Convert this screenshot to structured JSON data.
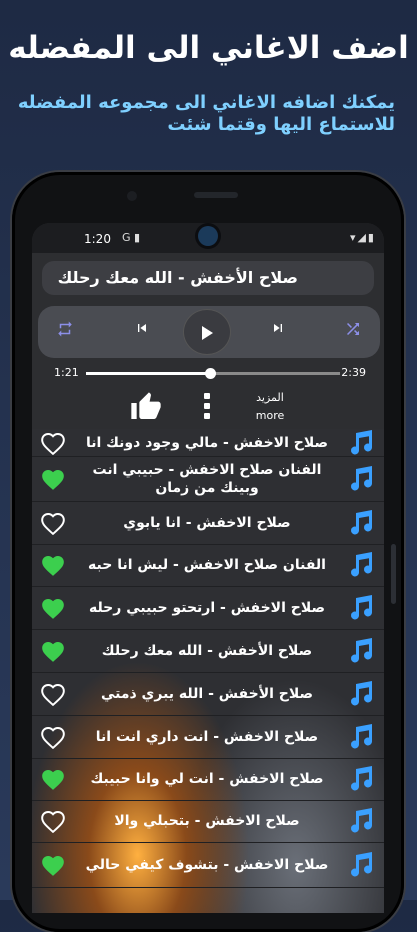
{
  "promo": {
    "title": "اضف الاغاني الى المفضله",
    "subtitle": "يمكنك اضافه الاغاني الى مجموعه المفضله للاستماع اليها وقتما شئت"
  },
  "status": {
    "time": "1:20",
    "left_icons": "G ▮",
    "right_icons": "▾◢▮"
  },
  "player": {
    "now_playing": "صلاح الأخفش - الله معك رحلك",
    "elapsed": "1:21",
    "duration": "2:39",
    "progress": 0.49,
    "more_ar": "المزيد",
    "more_en": "more"
  },
  "colors": {
    "accent": "#8c8fe8",
    "note": "#3aa0ff",
    "fav": "#3ccf4e"
  },
  "songs": [
    {
      "title": "صلاح الاخفش - مالي وجود دونك انا",
      "fav": false
    },
    {
      "title": "الفنان صلاح الاخفش - حبيبي انت وبينك من زمان",
      "fav": true
    },
    {
      "title": "صلاح الاخفش - انا يابوي",
      "fav": false
    },
    {
      "title": "الفنان صلاح الاخفش - ليش انا حبه",
      "fav": true
    },
    {
      "title": "صلاح الاخفش - ارتحتو حبيبي رحله",
      "fav": true
    },
    {
      "title": "صلاح الأخفش - الله معك رحلك",
      "fav": true
    },
    {
      "title": "صلاح الأخفش - الله يبري ذمتي",
      "fav": false
    },
    {
      "title": "صلاح الاخفش - انت داري انت انا",
      "fav": false
    },
    {
      "title": "صلاح الاخفش - انت لي وانا حبيبك",
      "fav": true
    },
    {
      "title": "صلاح الاخفش - بتحبلي والا",
      "fav": false
    },
    {
      "title": "صلاح الاخفش - بتشوف كيفي حالي",
      "fav": true
    }
  ]
}
